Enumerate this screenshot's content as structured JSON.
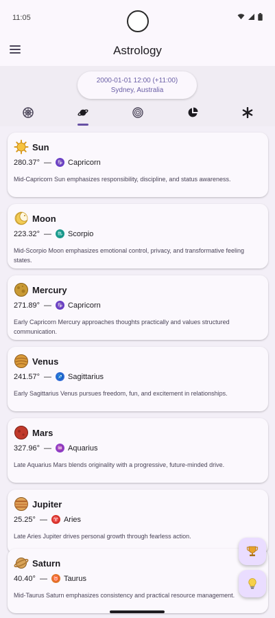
{
  "status_bar": {
    "time": "11:05"
  },
  "app_bar": {
    "title": "Astrology"
  },
  "header": {
    "datetime": "2000-01-01 12:00 (+11:00)",
    "location": "Sydney, Australia"
  },
  "tabs": [
    {
      "icon": "zodiac-wheel-icon",
      "active": false
    },
    {
      "icon": "planet-icon",
      "active": true
    },
    {
      "icon": "houses-wheel-icon",
      "active": false
    },
    {
      "icon": "pie-chart-icon",
      "active": false
    },
    {
      "icon": "asterisk-icon",
      "active": false
    }
  ],
  "planets": [
    {
      "name": "Sun",
      "degree": "280.37°",
      "separator": "—",
      "sign": "Capricorn",
      "sign_color": "#6a3fc7",
      "description": "Mid-Capricorn Sun emphasizes responsibility, discipline, and status awareness.",
      "icon": "sun-icon"
    },
    {
      "name": "Moon",
      "degree": "223.32°",
      "separator": "—",
      "sign": "Scorpio",
      "sign_color": "#1c9a8c",
      "description": "Mid-Scorpio Moon emphasizes emotional control, privacy, and transformative feeling states.",
      "icon": "moon-icon"
    },
    {
      "name": "Mercury",
      "degree": "271.89°",
      "separator": "—",
      "sign": "Capricorn",
      "sign_color": "#6a3fc7",
      "description": "Early Capricorn Mercury approaches thoughts practically and values structured communication.",
      "icon": "mercury-icon"
    },
    {
      "name": "Venus",
      "degree": "241.57°",
      "separator": "—",
      "sign": "Sagittarius",
      "sign_color": "#2f6bd6",
      "description": "Early Sagittarius Venus pursues freedom, fun, and excitement in relationships.",
      "icon": "venus-icon"
    },
    {
      "name": "Mars",
      "degree": "327.96°",
      "separator": "—",
      "sign": "Aquarius",
      "sign_color": "#8e3fc7",
      "description": "Late Aquarius Mars blends originality with a progressive, future-minded drive.",
      "icon": "mars-icon"
    },
    {
      "name": "Jupiter",
      "degree": "25.25°",
      "separator": "—",
      "sign": "Aries",
      "sign_color": "#d8342c",
      "description": "Late Aries Jupiter drives personal growth through fearless action.",
      "icon": "jupiter-icon"
    },
    {
      "name": "Saturn",
      "degree": "40.40°",
      "separator": "—",
      "sign": "Taurus",
      "sign_color": "#e0762a",
      "description": "Mid-Taurus Saturn emphasizes consistency and practical resource management.",
      "icon": "saturn-icon"
    }
  ],
  "fabs": [
    {
      "icon": "trophy-icon"
    },
    {
      "icon": "lightbulb-icon"
    }
  ]
}
